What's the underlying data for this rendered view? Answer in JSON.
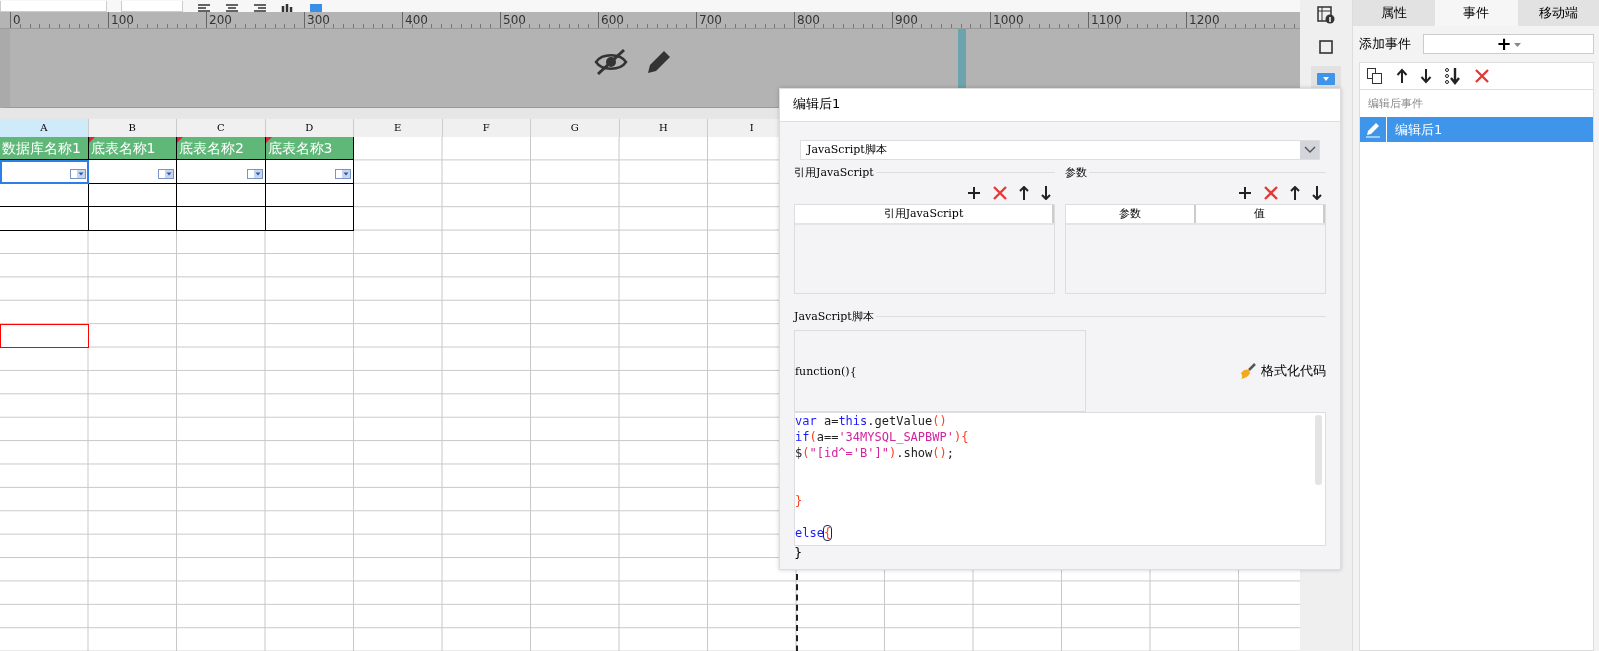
{
  "ruler": {
    "ticks": [
      "0",
      "100",
      "200",
      "300",
      "400",
      "500",
      "600",
      "700",
      "800",
      "900",
      "1000",
      "1100",
      "1200"
    ]
  },
  "sheet": {
    "columns": [
      {
        "label": "A",
        "selected": true
      },
      {
        "label": "B",
        "selected": false
      },
      {
        "label": "C",
        "selected": false
      },
      {
        "label": "D",
        "selected": false
      },
      {
        "label": "E",
        "selected": false
      },
      {
        "label": "F",
        "selected": false
      },
      {
        "label": "G",
        "selected": false
      },
      {
        "label": "H",
        "selected": false
      },
      {
        "label": "I",
        "selected": false
      }
    ],
    "header_cells": [
      {
        "text": "数据库名称1",
        "flagged": false
      },
      {
        "text": "底表名称1",
        "flagged": true
      },
      {
        "text": "底表名称2",
        "flagged": true
      },
      {
        "text": "底表名称3",
        "flagged": true
      }
    ],
    "combo_cells": [
      {
        "selected": true
      },
      {
        "selected": false
      },
      {
        "selected": false
      },
      {
        "selected": false
      }
    ]
  },
  "side_tools": [
    {
      "kind": "info",
      "selected": false
    },
    {
      "kind": "frame",
      "selected": false
    },
    {
      "kind": "combo",
      "selected": true
    }
  ],
  "dialog": {
    "title": "编辑后1",
    "type_select": {
      "value": "JavaScript脚本"
    },
    "references": {
      "title": "引用JavaScript",
      "columns": [
        "引用JavaScript"
      ]
    },
    "parameters": {
      "title": "参数",
      "columns": [
        "参数",
        "值"
      ]
    },
    "script": {
      "title": "JavaScript脚本",
      "header": "function(){",
      "format_button": "格式化代码",
      "lines": [
        {
          "kind": "code",
          "tokens": [
            {
              "kind": "keyword",
              "text": "var"
            },
            {
              "kind": "plain",
              "text": " a="
            },
            {
              "kind": "keyword",
              "text": "this"
            },
            {
              "kind": "plain",
              "text": ".getValue"
            },
            {
              "kind": "paren",
              "text": "()"
            }
          ]
        },
        {
          "kind": "code",
          "tokens": [
            {
              "kind": "keyword",
              "text": "if"
            },
            {
              "kind": "paren",
              "text": "("
            },
            {
              "kind": "plain",
              "text": "a=="
            },
            {
              "kind": "string",
              "text": "'34MYSQL_SAPBWP'"
            },
            {
              "kind": "paren",
              "text": "){"
            }
          ]
        },
        {
          "kind": "code",
          "tokens": [
            {
              "kind": "plain",
              "text": "$"
            },
            {
              "kind": "paren",
              "text": "("
            },
            {
              "kind": "string",
              "text": "\"[id^='B']\""
            },
            {
              "kind": "paren",
              "text": ")"
            },
            {
              "kind": "plain",
              "text": ".show"
            },
            {
              "kind": "paren",
              "text": "()"
            },
            {
              "kind": "plain",
              "text": ";"
            }
          ]
        },
        {
          "kind": "blank"
        },
        {
          "kind": "blank"
        },
        {
          "kind": "code",
          "tokens": [
            {
              "kind": "paren",
              "text": "}"
            }
          ]
        },
        {
          "kind": "blank"
        },
        {
          "kind": "code",
          "tokens": [
            {
              "kind": "keyword",
              "text": "else"
            },
            {
              "kind": "cursor",
              "text": "{"
            }
          ]
        }
      ],
      "footer": "}"
    }
  },
  "panel": {
    "tabs": [
      {
        "label": "属性",
        "selected": false
      },
      {
        "label": "事件",
        "selected": true
      },
      {
        "label": "移动端",
        "selected": false
      }
    ],
    "add_event": {
      "label": "添加事件",
      "button": "+"
    },
    "group": "编辑后事件",
    "events": [
      {
        "label": "编辑后1",
        "selected": true
      }
    ]
  }
}
